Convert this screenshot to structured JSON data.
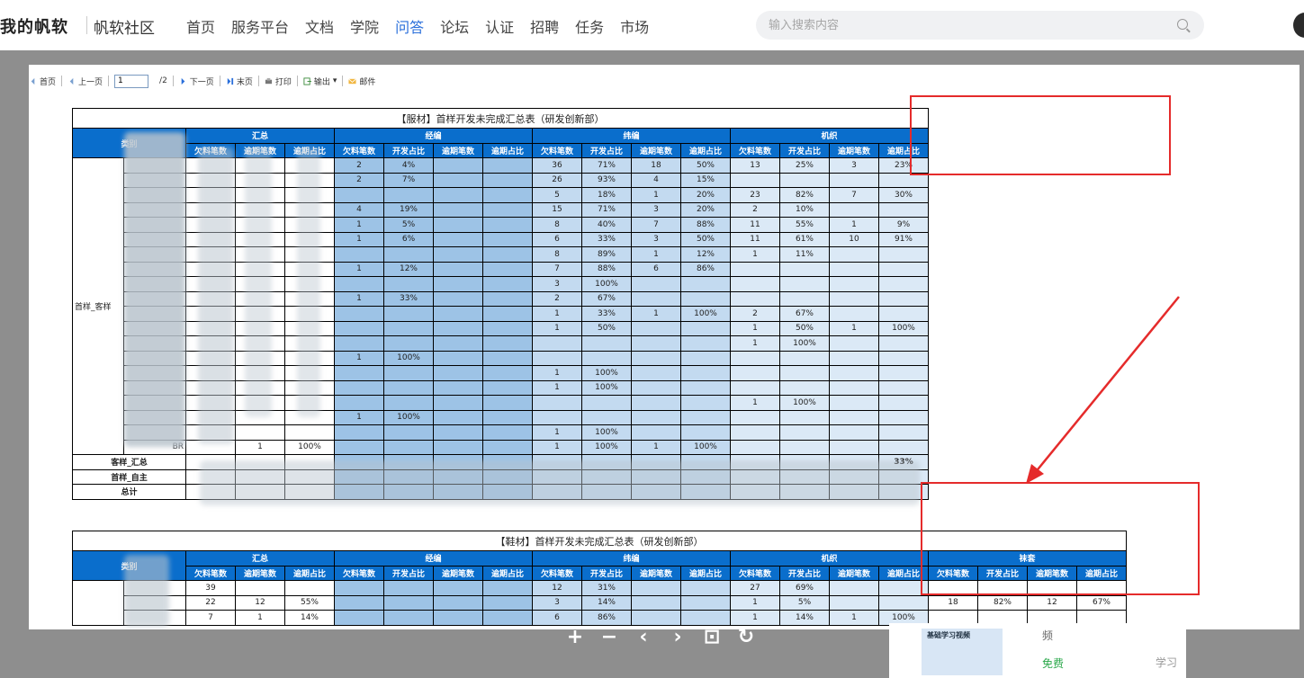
{
  "header": {
    "brand": "我的帆软",
    "community": "帆软社区",
    "nav": [
      "首页",
      "服务平台",
      "文档",
      "学院",
      "问答",
      "论坛",
      "认证",
      "招聘",
      "任务",
      "市场"
    ],
    "active_nav": "问答",
    "search_placeholder": "输入搜索内容"
  },
  "toolbar": {
    "first": "首页",
    "prev": "上一页",
    "page": "1",
    "total": "/2",
    "next": "下一页",
    "last": "末页",
    "print": "打印",
    "export": "输出",
    "mail": "邮件"
  },
  "colors": {
    "header_blue": "#0a6ecc",
    "col_mid": "#9dc3e6",
    "col_light": "#c3daf0",
    "col_pale": "#dbe9f6",
    "annotation_red": "#e52b2b",
    "overlay": "#8e8e8e"
  },
  "table1": {
    "title": "【服材】首样开发未完成汇总表（研发创新部）",
    "category_label": "类别",
    "groups": [
      "汇总",
      "经编",
      "纬编",
      "机织"
    ],
    "subheaders": [
      "欠料笔数",
      "逾期笔数",
      "逾期占比"
    ],
    "subheaders_dev": [
      "欠料笔数",
      "开发占比",
      "逾期笔数",
      "逾期占比"
    ],
    "row_group": "首样_客样",
    "rows": [
      [
        "",
        "",
        "",
        "2",
        "4%",
        "",
        "",
        "36",
        "71%",
        "18",
        "50%",
        "13",
        "25%",
        "3",
        "23%"
      ],
      [
        "",
        "",
        "",
        "2",
        "7%",
        "",
        "",
        "26",
        "93%",
        "4",
        "15%",
        "",
        "",
        "",
        ""
      ],
      [
        "",
        "",
        "",
        "",
        "",
        "",
        "",
        "5",
        "18%",
        "1",
        "20%",
        "23",
        "82%",
        "7",
        "30%"
      ],
      [
        "",
        "",
        "",
        "4",
        "19%",
        "",
        "",
        "15",
        "71%",
        "3",
        "20%",
        "2",
        "10%",
        "",
        ""
      ],
      [
        "",
        "",
        "",
        "1",
        "5%",
        "",
        "",
        "8",
        "40%",
        "7",
        "88%",
        "11",
        "55%",
        "1",
        "9%"
      ],
      [
        "",
        "",
        "",
        "1",
        "6%",
        "",
        "",
        "6",
        "33%",
        "3",
        "50%",
        "11",
        "61%",
        "10",
        "91%"
      ],
      [
        "",
        "",
        "",
        "",
        "",
        "",
        "",
        "8",
        "89%",
        "1",
        "12%",
        "1",
        "11%",
        "",
        ""
      ],
      [
        "",
        "",
        "",
        "1",
        "12%",
        "",
        "",
        "7",
        "88%",
        "6",
        "86%",
        "",
        "",
        "",
        ""
      ],
      [
        "",
        "",
        "",
        "",
        "",
        "",
        "",
        "3",
        "100%",
        "",
        "",
        "",
        "",
        "",
        ""
      ],
      [
        "",
        "",
        "",
        "1",
        "33%",
        "",
        "",
        "2",
        "67%",
        "",
        "",
        "",
        "",
        "",
        ""
      ],
      [
        "",
        "",
        "",
        "",
        "",
        "",
        "",
        "1",
        "33%",
        "1",
        "100%",
        "2",
        "67%",
        "",
        ""
      ],
      [
        "",
        "",
        "",
        "",
        "",
        "",
        "",
        "1",
        "50%",
        "",
        "",
        "1",
        "50%",
        "1",
        "100%"
      ],
      [
        "",
        "",
        "",
        "",
        "",
        "",
        "",
        "",
        "",
        "",
        "",
        "1",
        "100%",
        "",
        ""
      ],
      [
        "",
        "",
        "",
        "1",
        "100%",
        "",
        "",
        "",
        "",
        "",
        "",
        "",
        "",
        "",
        ""
      ],
      [
        "",
        "",
        "",
        "",
        "",
        "",
        "",
        "1",
        "100%",
        "",
        "",
        "",
        "",
        "",
        ""
      ],
      [
        "",
        "",
        "",
        "",
        "",
        "",
        "",
        "1",
        "100%",
        "",
        "",
        "",
        "",
        "",
        ""
      ],
      [
        "",
        "",
        "",
        "",
        "",
        "",
        "",
        "",
        "",
        "",
        "",
        "1",
        "100%",
        "",
        ""
      ],
      [
        "",
        "",
        "",
        "1",
        "100%",
        "",
        "",
        "",
        "",
        "",
        "",
        "",
        "",
        "",
        ""
      ],
      [
        "",
        "",
        "",
        "",
        "",
        "",
        "",
        "1",
        "100%",
        "",
        "",
        "",
        "",
        "",
        ""
      ],
      [
        "",
        "1",
        "100%",
        "",
        "",
        "",
        "",
        "1",
        "100%",
        "1",
        "100%",
        "",
        "",
        "",
        ""
      ]
    ],
    "last_row_suffix": "BR",
    "summary_rows": [
      {
        "label": "客样_汇总",
        "end": "33%"
      },
      {
        "label": "首样_自主",
        "end": ""
      },
      {
        "label": "总计",
        "end": ""
      }
    ]
  },
  "table2": {
    "title": "【鞋材】首样开发未完成汇总表（研发创新部）",
    "category_label": "类别",
    "groups": [
      "汇总",
      "经编",
      "纬编",
      "机织",
      "袜套"
    ],
    "rows": [
      [
        "39",
        "",
        "",
        "",
        "",
        "",
        "",
        "12",
        "31%",
        "",
        "",
        "27",
        "69%",
        "",
        "",
        "",
        "",
        "",
        ""
      ],
      [
        "22",
        "12",
        "55%",
        "",
        "",
        "",
        "",
        "3",
        "14%",
        "",
        "",
        "1",
        "5%",
        "",
        "",
        "18",
        "82%",
        "12",
        "67%"
      ],
      [
        "7",
        "1",
        "14%",
        "",
        "",
        "",
        "",
        "6",
        "86%",
        "",
        "",
        "1",
        "14%",
        "1",
        "100%",
        "",
        "",
        "",
        ""
      ]
    ]
  },
  "controls": [
    "+",
    "−",
    "‹",
    "›"
  ],
  "promo": {
    "title": "基础学习视频",
    "right": "频",
    "free": "免费",
    "learn": "学习"
  }
}
